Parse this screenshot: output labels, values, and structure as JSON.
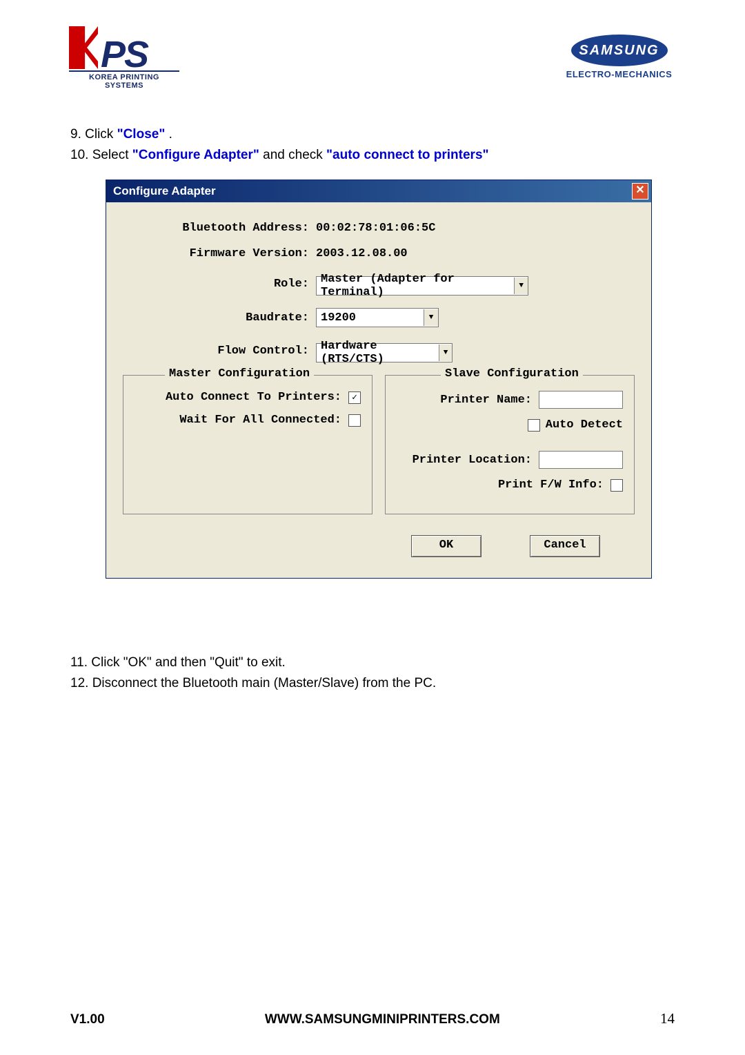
{
  "logos": {
    "kps": {
      "ps_text": "PS",
      "subtitle": "KOREA PRINTING SYSTEMS"
    },
    "samsung": {
      "brand": "SAMSUNG",
      "subtitle": "ELECTRO-MECHANICS"
    }
  },
  "instructions_top": {
    "line1_prefix": "9. Click ",
    "line1_blue": "\"Close\"",
    "line1_suffix": " .",
    "line2_prefix": "10. Select ",
    "line2_blue1": "\"Configure Adapter\"",
    "line2_mid": " and check ",
    "line2_blue2": "\"auto connect to printers\""
  },
  "dialog": {
    "title": "Configure Adapter",
    "close_x": "✕",
    "labels": {
      "bt_addr": "Bluetooth Address:",
      "fw_ver": "Firmware Version:",
      "role": "Role:",
      "baud": "Baudrate:",
      "flow": "Flow Control:"
    },
    "values": {
      "bt_addr": "00:02:78:01:06:5C",
      "fw_ver": "2003.12.08.00",
      "role": "Master (Adapter for Terminal)",
      "baud": "19200",
      "flow": "Hardware (RTS/CTS)"
    },
    "arrow": "▼",
    "group_master": {
      "legend": "Master Configuration",
      "auto_connect_label": "Auto Connect To Printers:",
      "wait_all_label": "Wait For All Connected:"
    },
    "group_slave": {
      "legend": "Slave Configuration",
      "printer_name_label": "Printer Name:",
      "auto_detect_label": "Auto Detect",
      "printer_loc_label": "Printer Location:",
      "print_fw_label": "Print F/W Info:"
    },
    "buttons": {
      "ok": "OK",
      "cancel": "Cancel"
    }
  },
  "instructions_below": {
    "line1_prefix": "11. Click ",
    "line1_blue1": "\"OK\"",
    "line1_mid": " and then ",
    "line1_blue2": "\"Quit\"",
    "line1_suffix": " to exit.",
    "line2": "12. Disconnect the Bluetooth main (Master/Slave) from the PC."
  },
  "footer": {
    "left": "V1.00",
    "center": "WWW.SAMSUNGMINIPRINTERS.COM",
    "right": "14"
  }
}
